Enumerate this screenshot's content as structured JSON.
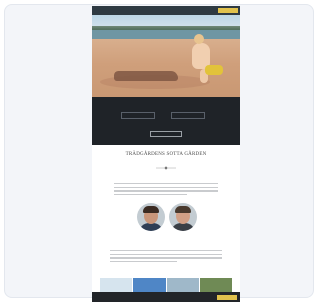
{
  "nav": {
    "logo": "",
    "links": [
      "",
      "",
      "",
      "",
      "",
      "",
      "",
      ""
    ],
    "cta": ""
  },
  "band": {
    "buttons": [
      "",
      ""
    ],
    "link": ""
  },
  "content": {
    "title": "TRÄDGÅRDENS SOTTA GÅRDEN",
    "subhead": "",
    "names": ""
  },
  "cookie": {
    "text": "",
    "button": ""
  },
  "colors": {
    "nav_bg": "#2e3a42",
    "accent": "#e1c24d",
    "band_bg": "#1f2328",
    "card_bg": "#f3f5f9"
  },
  "icons": [
    "divider-ornament-icon"
  ]
}
